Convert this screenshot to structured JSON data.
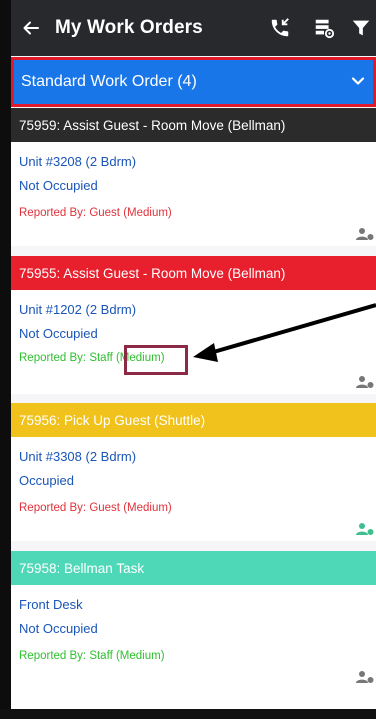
{
  "header": {
    "title": "My Work Orders",
    "back_icon": "arrow-left-icon",
    "icons": [
      "phone-callback-icon",
      "server-settings-icon",
      "filter-icon"
    ]
  },
  "group": {
    "label": "Standard Work Order (4)",
    "expand_icon": "chevron-down-icon",
    "color": "#1976e8"
  },
  "orders": [
    {
      "title": "75959: Assist Guest - Room Move (Bellman)",
      "header_color": "#2b2b2b",
      "unit": "Unit #3208 (2 Bdrm)",
      "occupancy": "Not Occupied",
      "reported_label": "Reported By: Guest",
      "priority": "(Medium)",
      "reported_color": "#e0323a",
      "assign_icon_color": "#777777"
    },
    {
      "title": "75955: Assist Guest - Room Move (Bellman)",
      "header_color": "#e8202e",
      "unit": "Unit #1202 (2 Bdrm)",
      "occupancy": "Not Occupied",
      "reported_label": "Reported By: Staff",
      "priority": "(Medium)",
      "reported_color": "#2fbf2f",
      "assign_icon_color": "#777777"
    },
    {
      "title": "75956: Pick Up Guest (Shuttle)",
      "header_color": "#f1c21b",
      "unit": "Unit #3308 (2 Bdrm)",
      "occupancy": "Occupied",
      "reported_label": "Reported By: Guest",
      "priority": "(Medium)",
      "reported_color": "#e0323a",
      "assign_icon_color": "#3fbf8f"
    },
    {
      "title": "75958: Bellman Task",
      "header_color": "#4fd8b8",
      "unit": "Front Desk",
      "occupancy": "Not Occupied",
      "reported_label": "Reported By: Staff",
      "priority": "(Medium)",
      "reported_color": "#2fbf2f",
      "assign_icon_color": "#777777"
    }
  ],
  "annotation": {
    "highlight_color": "#8b2a45",
    "arrow_color": "#000000"
  }
}
